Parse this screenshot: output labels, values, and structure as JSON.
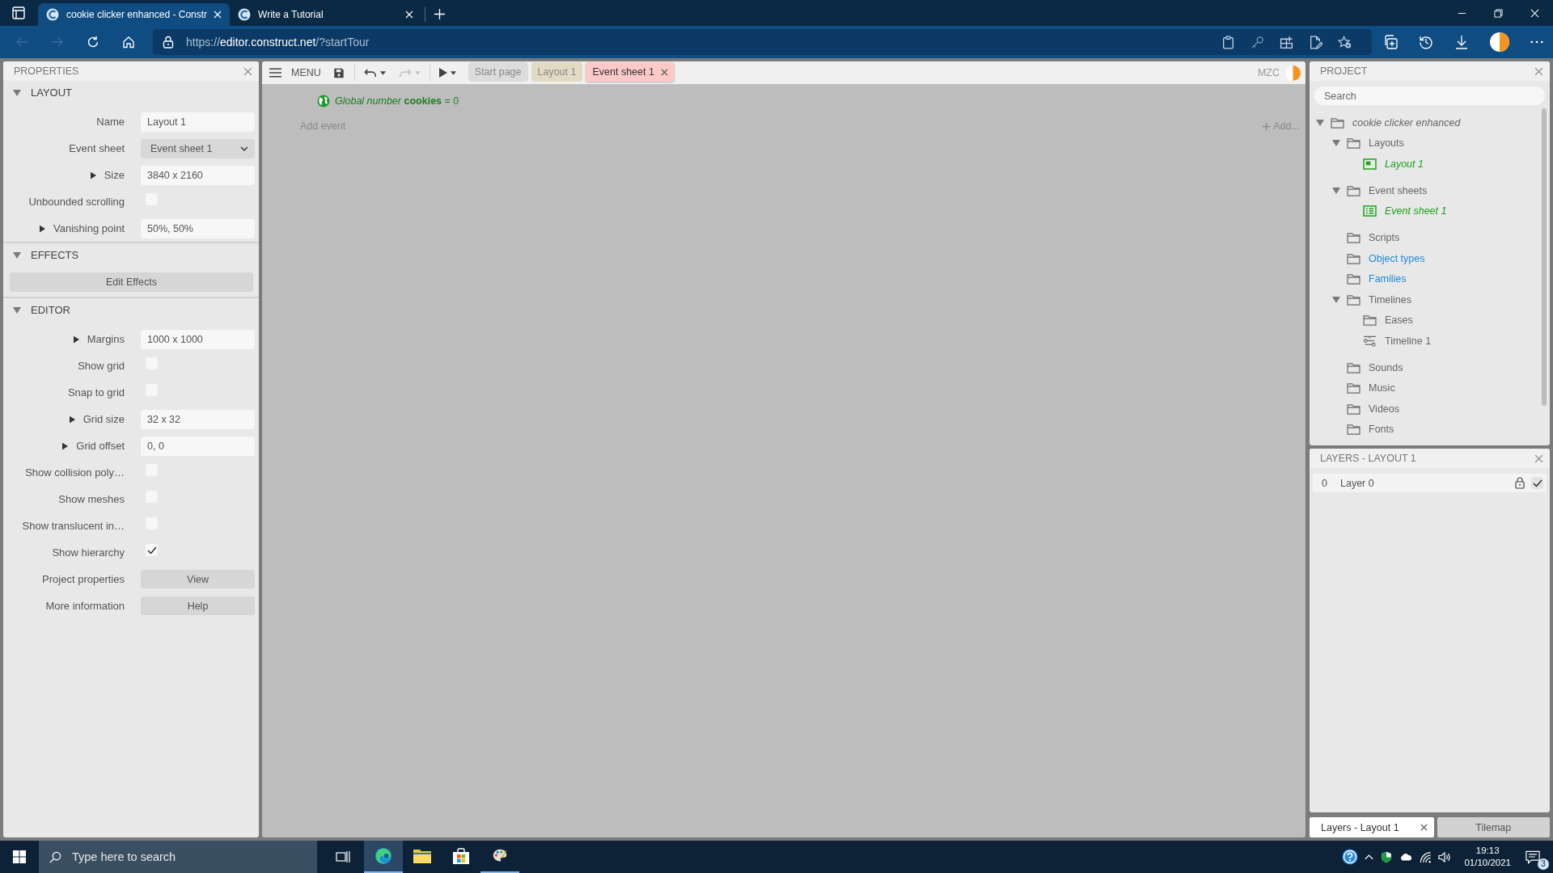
{
  "browser": {
    "tabs": [
      {
        "title": "cookie clicker enhanced - Constr",
        "selected": true
      },
      {
        "title": "Write a Tutorial",
        "selected": false
      }
    ],
    "nav_buttons": [
      {
        "kind": "back",
        "disabled": true
      },
      {
        "kind": "forward",
        "disabled": true
      },
      {
        "kind": "refresh",
        "disabled": false
      },
      {
        "kind": "home",
        "disabled": false
      }
    ],
    "address": {
      "scheme": "https://",
      "host": "editor.construct.net",
      "path": "/?startTour"
    }
  },
  "properties": {
    "title": "PROPERTIES",
    "sections": [
      {
        "title": "LAYOUT",
        "expanded": true,
        "rows": [
          {
            "kind": "text",
            "label": "Name",
            "value": "Layout 1"
          },
          {
            "kind": "select",
            "label": "Event sheet",
            "value": "Event sheet 1"
          },
          {
            "kind": "text",
            "label": "Size",
            "value": "3840 x 2160",
            "expanded": false
          },
          {
            "kind": "checkbox",
            "label": "Unbounded scrolling",
            "checked": false
          },
          {
            "kind": "text",
            "label": "Vanishing point",
            "value": "50%, 50%",
            "expanded": false
          }
        ]
      },
      {
        "title": "EFFECTS",
        "expanded": true,
        "rows": [
          {
            "kind": "wide_button",
            "label": "Edit Effects"
          }
        ]
      },
      {
        "title": "EDITOR",
        "expanded": true,
        "rows": [
          {
            "kind": "text",
            "label": "Margins",
            "value": "1000 x 1000",
            "expanded": false
          },
          {
            "kind": "checkbox",
            "label": "Show grid",
            "checked": false
          },
          {
            "kind": "checkbox",
            "label": "Snap to grid",
            "checked": false
          },
          {
            "kind": "text",
            "label": "Grid size",
            "value": "32 x 32",
            "expanded": false
          },
          {
            "kind": "text",
            "label": "Grid offset",
            "value": "0, 0",
            "expanded": false
          },
          {
            "kind": "checkbox",
            "label": "Show collision poly…",
            "checked": false
          },
          {
            "kind": "checkbox",
            "label": "Show meshes",
            "checked": false
          },
          {
            "kind": "checkbox",
            "label": "Show translucent in…",
            "checked": false
          },
          {
            "kind": "checkbox",
            "label": "Show hierarchy",
            "checked": true
          },
          {
            "kind": "button",
            "label": "Project properties",
            "value": "View"
          },
          {
            "kind": "button",
            "label": "More information",
            "value": "Help"
          }
        ]
      }
    ]
  },
  "editor": {
    "menu_label": "MENU",
    "tools": [
      {
        "kind": "save",
        "disabled": false
      },
      {
        "kind": "undo",
        "disabled": false
      },
      {
        "kind": "redo",
        "disabled": true
      },
      {
        "kind": "preview",
        "disabled": false
      }
    ],
    "tabs": [
      {
        "label": "Start page",
        "color": "#dcdcdc",
        "selected": false
      },
      {
        "label": "Layout 1",
        "color": "#e2dbc4",
        "selected": false
      },
      {
        "label": "Event sheet 1",
        "color": "#fcc8c8",
        "selected": true
      }
    ],
    "user": "MZC",
    "events": [
      {
        "kind": "global_variable",
        "text": "*Global number* **cookies** = 0"
      }
    ],
    "add_event": "Add event",
    "add_action": "Add..."
  },
  "project": {
    "title": "PROJECT",
    "search_placeholder": "Search",
    "tree": [
      {
        "label": "cookie clicker enhanced",
        "kind": "project",
        "color": "#666666",
        "open": true,
        "expanded": true,
        "children": [
          {
            "label": "Layouts",
            "kind": "folder",
            "color": "#666666",
            "open": false,
            "expanded": true,
            "children": [
              {
                "label": "Layout 1",
                "kind": "layout",
                "color": "#1aa31a",
                "open": true
              }
            ]
          },
          {
            "label": "Event sheets",
            "kind": "folder",
            "color": "#666666",
            "open": false,
            "expanded": true,
            "children": [
              {
                "label": "Event sheet 1",
                "kind": "event_sheet",
                "color": "#1aa31a",
                "open": true
              }
            ]
          },
          {
            "label": "Scripts",
            "kind": "folder",
            "color": "#666666",
            "open": false
          },
          {
            "label": "Object types",
            "kind": "folder",
            "color": "#1e8ad6",
            "open": false
          },
          {
            "label": "Families",
            "kind": "folder",
            "color": "#1e8ad6",
            "open": false
          },
          {
            "label": "Timelines",
            "kind": "folder",
            "color": "#666666",
            "open": false,
            "expanded": true,
            "children": [
              {
                "label": "Eases",
                "kind": "folder",
                "color": "#666666",
                "open": false
              },
              {
                "label": "Timeline 1",
                "kind": "timeline",
                "color": "#666666",
                "open": false
              }
            ]
          },
          {
            "label": "Sounds",
            "kind": "folder",
            "color": "#666666",
            "open": false
          },
          {
            "label": "Music",
            "kind": "folder",
            "color": "#666666",
            "open": false
          },
          {
            "label": "Videos",
            "kind": "folder",
            "color": "#666666",
            "open": false
          },
          {
            "label": "Fonts",
            "kind": "folder",
            "color": "#666666",
            "open": false
          }
        ]
      }
    ]
  },
  "layers": {
    "title": "LAYERS - LAYOUT 1",
    "rows": [
      {
        "index": "0",
        "name": "Layer 0",
        "visible": true
      }
    ]
  },
  "bottom_tabs": [
    {
      "label": "Layers - Layout 1",
      "selected": true
    },
    {
      "label": "Tilemap",
      "selected": false
    }
  ],
  "taskbar": {
    "search_placeholder": "Type here to search",
    "apps": [
      {
        "kind": "edge",
        "selected": true,
        "running": true
      },
      {
        "kind": "explorer",
        "selected": false,
        "running": false
      },
      {
        "kind": "store",
        "selected": false,
        "running": false
      },
      {
        "kind": "paint",
        "selected": false,
        "running": true
      }
    ],
    "time": "19:13",
    "date": "01/10/2021",
    "notification_count": "3"
  }
}
